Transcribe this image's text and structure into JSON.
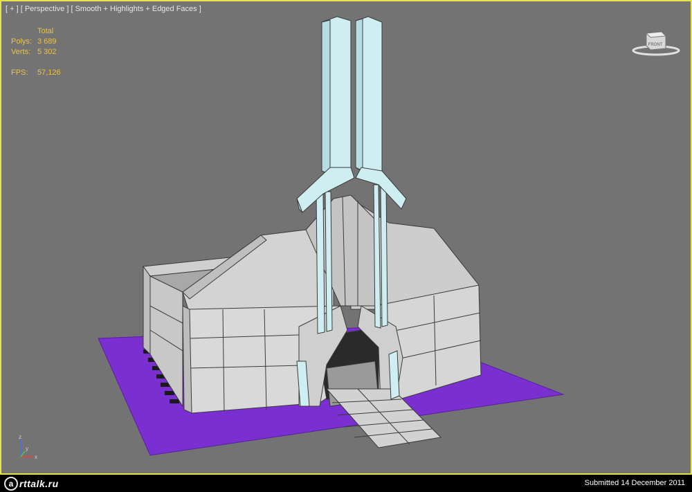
{
  "viewport": {
    "label": "[ + ] [ Perspective ] [ Smooth + Highlights + Edged Faces ]",
    "stats": {
      "header": "Total",
      "polys_label": "Polys:",
      "polys_value": "3 689",
      "verts_label": "Verts:",
      "verts_value": "5 302",
      "fps_label": "FPS:",
      "fps_value": "57,126"
    },
    "viewcube_label": "FRONT",
    "axis": {
      "x": "x",
      "y": "y",
      "z": "z"
    },
    "colors": {
      "background": "#737373",
      "border_active": "#e8e34a",
      "ground_plane": "#7a2fd0",
      "walls": "#d7d7d7",
      "glass": "#cfeef2"
    }
  },
  "footer": {
    "brand_glyph": "a",
    "brand_text": "rttalk.ru",
    "submitted": "Submitted 14 December 2011"
  }
}
